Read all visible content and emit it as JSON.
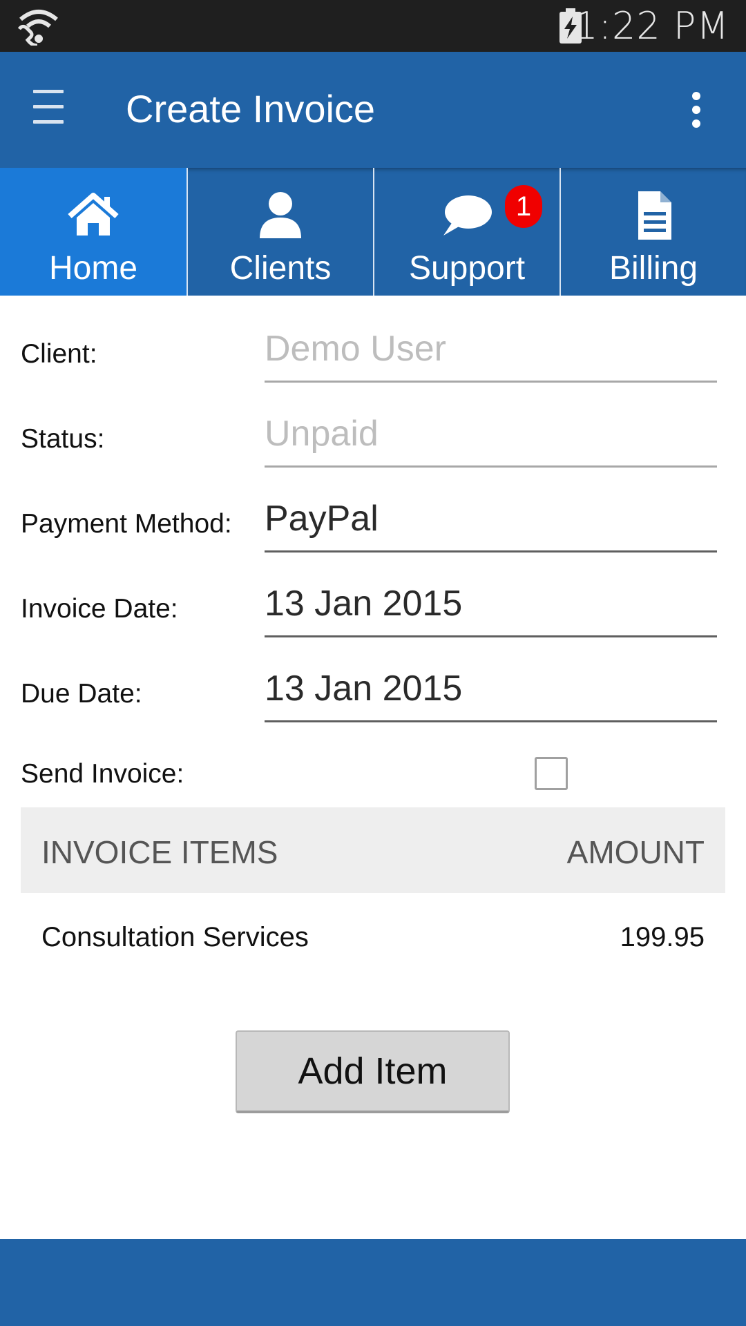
{
  "status_bar": {
    "time": "1:22 PM"
  },
  "app_bar": {
    "title": "Create Invoice"
  },
  "tabs": [
    {
      "label": "Home",
      "icon": "home-icon",
      "selected": true
    },
    {
      "label": "Clients",
      "icon": "person-icon",
      "selected": false
    },
    {
      "label": "Support",
      "icon": "chat-bubble-icon",
      "selected": false,
      "badge": "1"
    },
    {
      "label": "Billing",
      "icon": "document-icon",
      "selected": false
    }
  ],
  "form": {
    "client": {
      "label": "Client:",
      "placeholder": "Demo User"
    },
    "status": {
      "label": "Status:",
      "placeholder": "Unpaid"
    },
    "payment_method": {
      "label": "Payment Method:",
      "value": "PayPal"
    },
    "invoice_date": {
      "label": "Invoice Date:",
      "value": "13 Jan 2015"
    },
    "due_date": {
      "label": "Due Date:",
      "value": "13 Jan 2015"
    },
    "send_invoice": {
      "label": "Send Invoice:",
      "checked": false
    }
  },
  "items_table": {
    "headers": [
      "INVOICE ITEMS",
      "AMOUNT"
    ],
    "rows": [
      {
        "name": "Consultation Services",
        "amount": "199.95"
      }
    ]
  },
  "add_item_label": "Add Item",
  "colors": {
    "primary": "#2163a6",
    "selected_tab": "#1b7ad8",
    "badge": "#f00000",
    "status_bar": "#1f1f1f"
  }
}
